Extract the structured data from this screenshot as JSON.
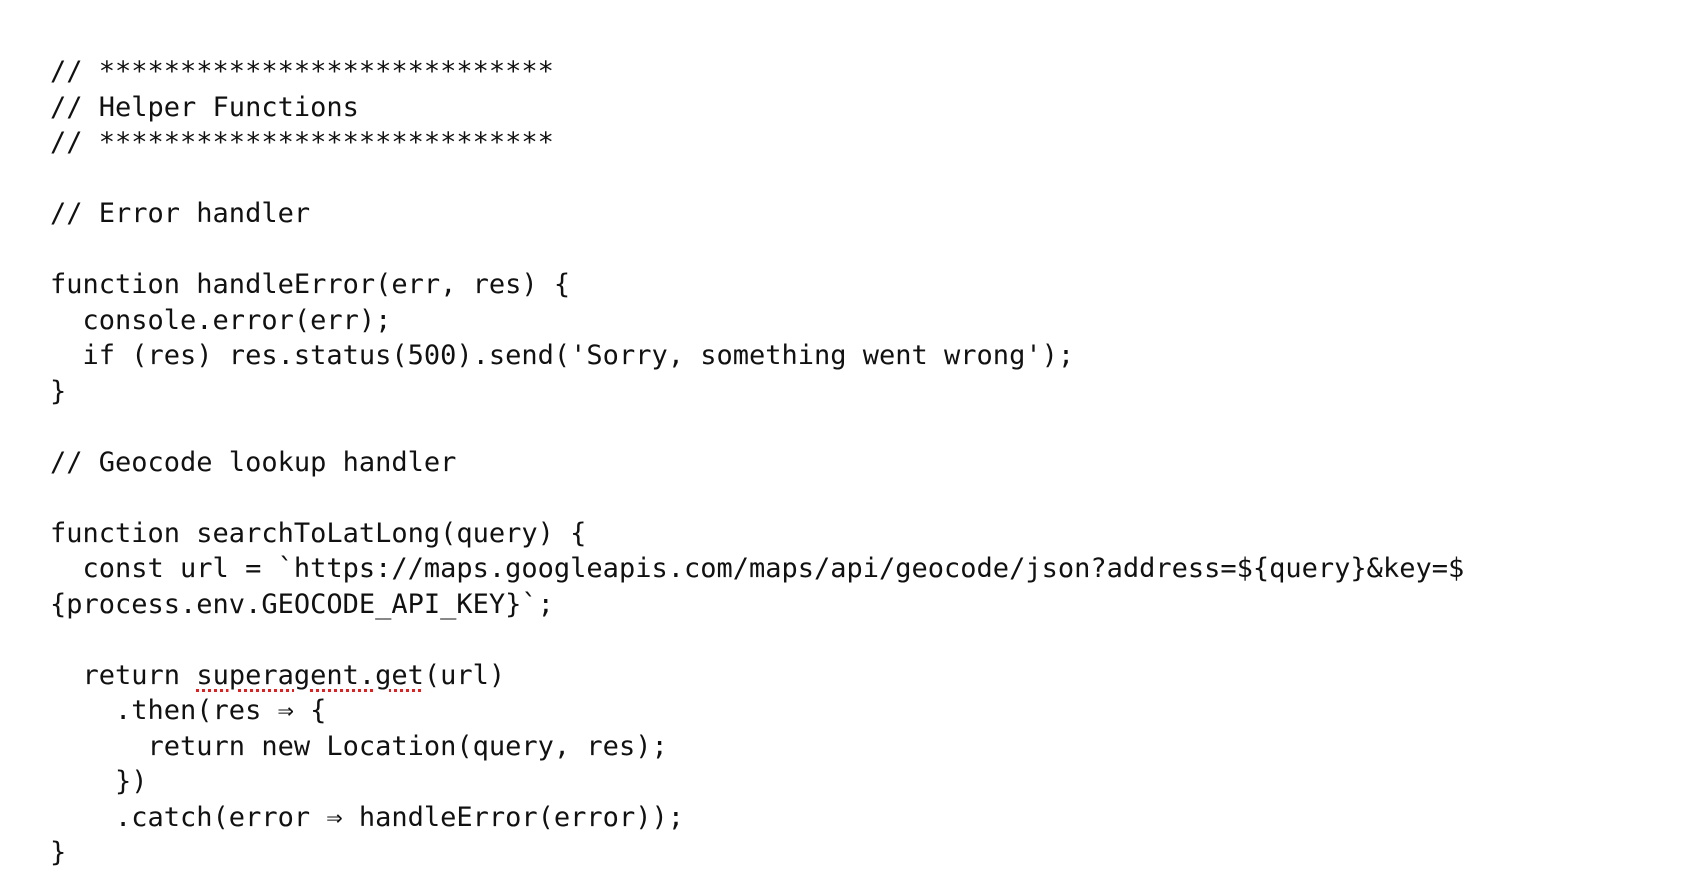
{
  "editor": {
    "lines": [
      "// ****************************",
      "// Helper Functions",
      "// ****************************",
      "",
      "// Error handler",
      "",
      "function handleError(err, res) {",
      "  console.error(err);",
      "  if (res) res.status(500).send('Sorry, something went wrong');",
      "}",
      "",
      "// Geocode lookup handler",
      "",
      "function searchToLatLong(query) {",
      "  const url = `https://maps.googleapis.com/maps/api/geocode/json?address=${query}&key=$",
      "{process.env.GEOCODE_API_KEY}`;",
      "",
      "  return ",
      "superagent.get",
      "(url)",
      "    .then(res ⇒ {",
      "      return new Location(query, res);",
      "    })",
      "    .catch(error ⇒ handleError(error));",
      "}"
    ],
    "squiggle_color": "#e02020",
    "text_color": "#111111",
    "background": "#ffffff"
  }
}
